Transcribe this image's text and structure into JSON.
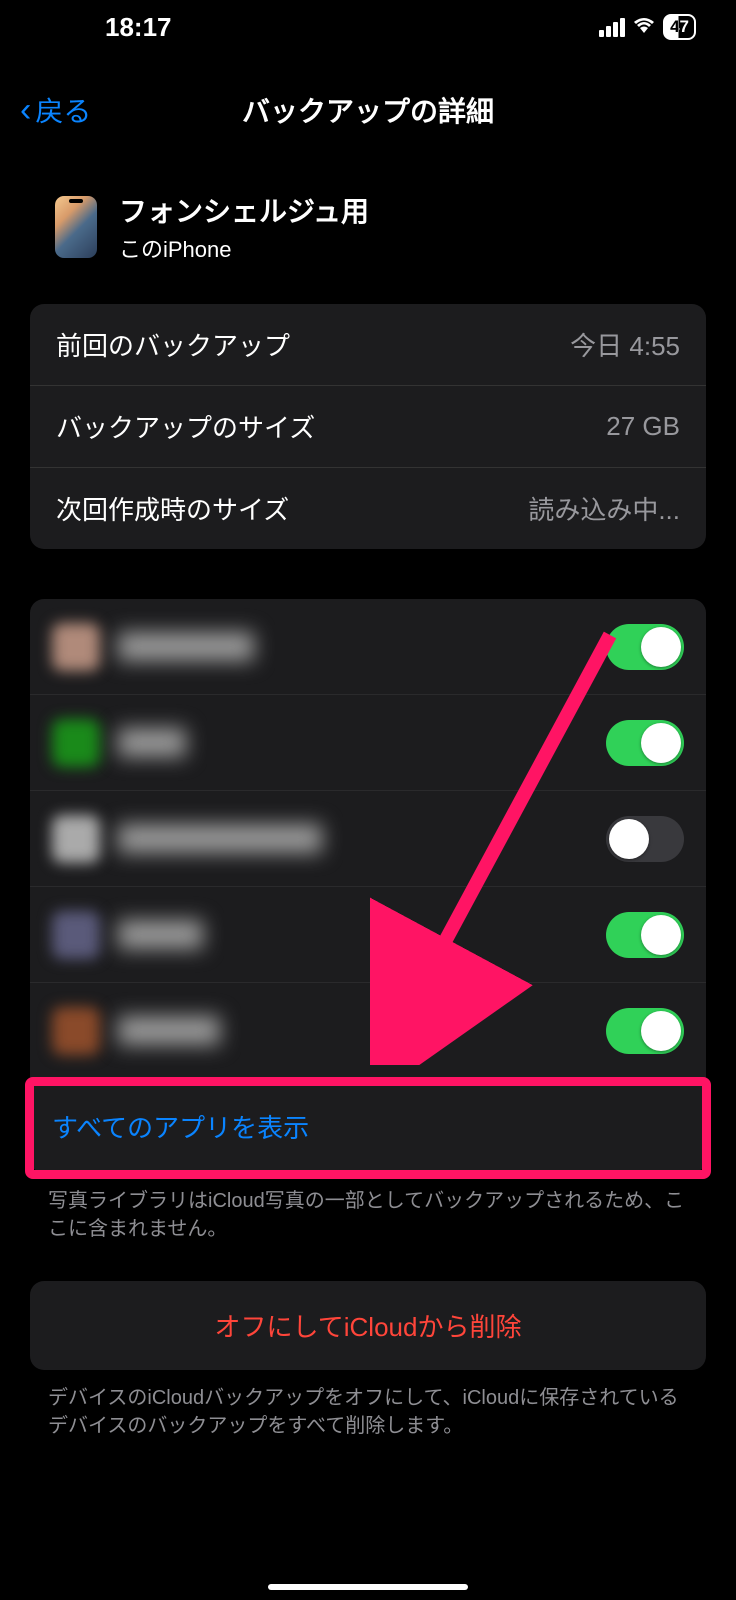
{
  "statusBar": {
    "time": "18:17",
    "battery": "47"
  },
  "nav": {
    "back": "戻る",
    "title": "バックアップの詳細"
  },
  "device": {
    "name": "フォンシェルジュ用",
    "sub": "このiPhone"
  },
  "info": {
    "lastBackup": {
      "label": "前回のバックアップ",
      "value": "今日 4:55"
    },
    "size": {
      "label": "バックアップのサイズ",
      "value": "27 GB"
    },
    "nextSize": {
      "label": "次回作成時のサイズ",
      "value": "読み込み中..."
    }
  },
  "apps": [
    {
      "iconColor": "#b08a7a",
      "on": true
    },
    {
      "iconColor": "#1a5a1a",
      "on": true
    },
    {
      "iconColor": "#888",
      "on": false
    },
    {
      "iconColor": "#5a5a5a",
      "on": true
    },
    {
      "iconColor": "#7a4a2a",
      "on": true
    }
  ],
  "showAll": "すべてのアプリを表示",
  "photoNote": "写真ライブラリはiCloud写真の一部としてバックアップされるため、ここに含まれません。",
  "deleteBtn": "オフにしてiCloudから削除",
  "deleteNote": "デバイスのiCloudバックアップをオフにして、iCloudに保存されているデバイスのバックアップをすべて削除します。"
}
